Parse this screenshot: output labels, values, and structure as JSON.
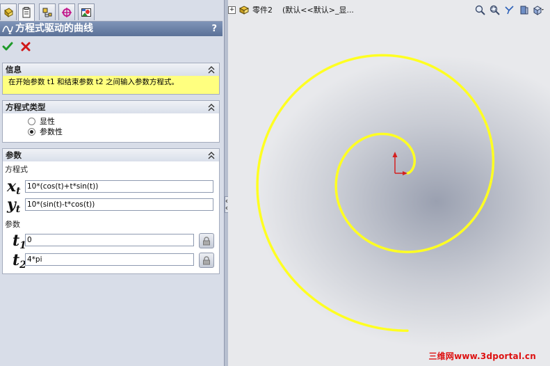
{
  "title": "方程式驱动的曲线",
  "help": "?",
  "sections": {
    "info": {
      "header": "信息",
      "message": "在开始参数 t1 和结束参数 t2 之间输入参数方程式。"
    },
    "type": {
      "header": "方程式类型",
      "options": [
        {
          "label": "显性",
          "selected": false
        },
        {
          "label": "参数性",
          "selected": true
        }
      ]
    },
    "params": {
      "header": "参数",
      "equation_label": "方程式",
      "xt_var": "x",
      "xt_sub": "t",
      "yt_var": "y",
      "yt_sub": "t",
      "xt_value": "10*(cos(t)+t*sin(t))",
      "yt_value": "10*(sin(t)-t*cos(t))",
      "param_label": "参数",
      "t1_var": "t",
      "t1_sub": "1",
      "t2_var": "t",
      "t2_sub": "2",
      "t1_value": "0",
      "t2_value": "4*pi"
    }
  },
  "graphics": {
    "tree_part": "零件2",
    "tree_config": "(默认<<默认>_显...",
    "curve_color": "#ffff22",
    "watermark": "三维网www.3dportal.cn"
  }
}
